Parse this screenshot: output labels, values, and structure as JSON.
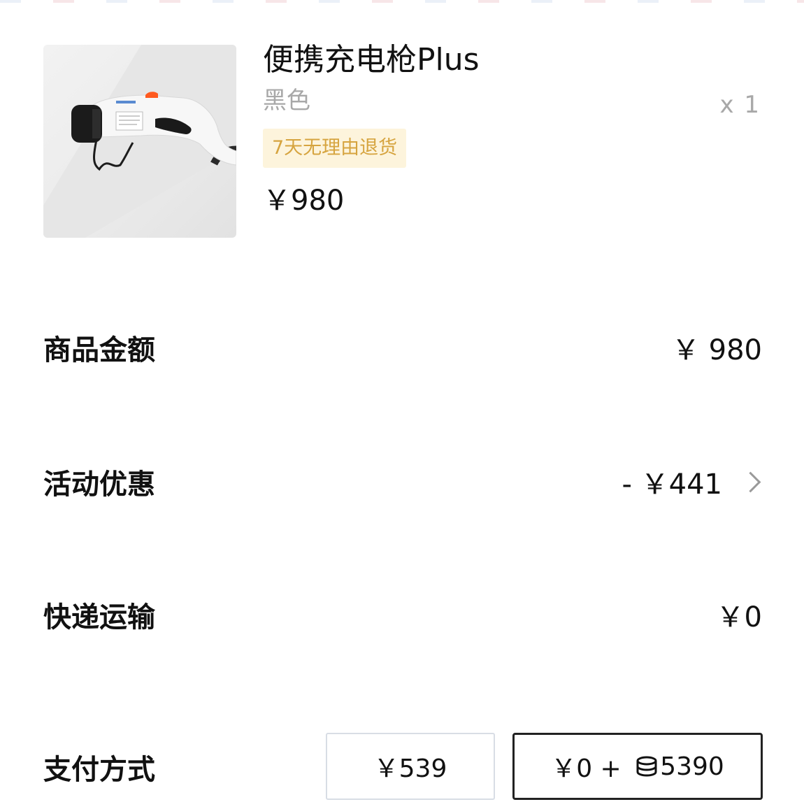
{
  "product": {
    "title": "便携充电枪Plus",
    "color": "黑色",
    "quantity": "x 1",
    "badge": "7天无理由退货",
    "price": "￥980",
    "image_icon": "ev-charger-gun-image"
  },
  "summary": {
    "goods_amount": {
      "label": "商品金额",
      "value": "￥ 980"
    },
    "discount": {
      "label": "活动优惠",
      "value": "- ￥441"
    },
    "shipping": {
      "label": "快递运输",
      "value": "￥0"
    }
  },
  "payment": {
    "label": "支付方式",
    "options": [
      {
        "text": "￥539",
        "selected": false
      },
      {
        "text_prefix": "￥0 + ",
        "points": "5390",
        "selected": true
      }
    ]
  },
  "colors": {
    "badge_bg": "#fdf4dc",
    "badge_text": "#d6a43f",
    "muted_text": "#a8a8a8",
    "selected_border": "#222222"
  }
}
